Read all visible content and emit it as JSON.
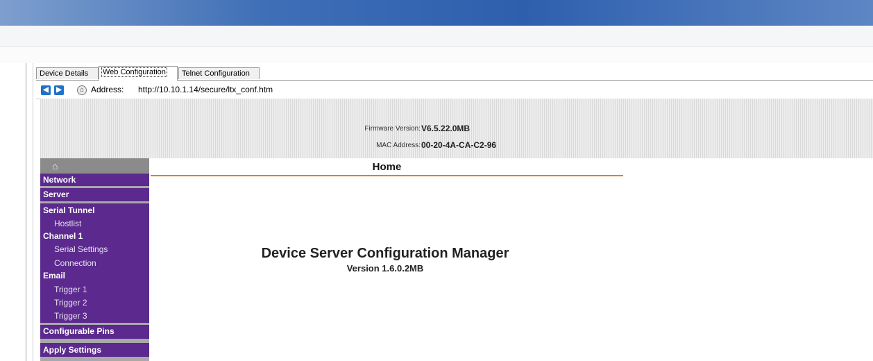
{
  "tabs": [
    {
      "label": "Device Details"
    },
    {
      "label": "Web Configuration"
    },
    {
      "label": "Telnet Configuration"
    }
  ],
  "address_bar": {
    "back_icon": "back-arrow-icon",
    "forward_icon": "forward-arrow-icon",
    "home_icon": "home-icon",
    "label": "Address:",
    "url": "http://10.10.1.14/secure/ltx_conf.htm"
  },
  "device_info": {
    "firmware_label": "Firmware Version:",
    "firmware_value": "V6.5.22.0MB",
    "mac_label": "MAC Address:",
    "mac_value": "00-20-4A-CA-C2-96"
  },
  "sidebar": {
    "home_icon": "⌂",
    "items": [
      {
        "label": "Network",
        "level": "main"
      },
      {
        "label": "Server",
        "level": "main"
      },
      {
        "label": "Serial Tunnel",
        "level": "main"
      },
      {
        "label": "Hostlist",
        "level": "sub"
      },
      {
        "label": "Channel 1",
        "level": "main"
      },
      {
        "label": "Serial Settings",
        "level": "sub"
      },
      {
        "label": "Connection",
        "level": "sub"
      },
      {
        "label": "Email",
        "level": "main"
      },
      {
        "label": "Trigger 1",
        "level": "sub"
      },
      {
        "label": "Trigger 2",
        "level": "sub"
      },
      {
        "label": "Trigger 3",
        "level": "sub"
      },
      {
        "label": "Configurable Pins",
        "level": "main"
      },
      {
        "label": "Apply Settings",
        "level": "main"
      }
    ]
  },
  "main": {
    "heading": "Home",
    "title": "Device Server Configuration Manager",
    "version": "Version 1.6.0.2MB"
  },
  "colors": {
    "sidebar_bg": "#5c2a8e",
    "accent_line": "#e77a2a",
    "title_bar": "#3f6fb6"
  }
}
